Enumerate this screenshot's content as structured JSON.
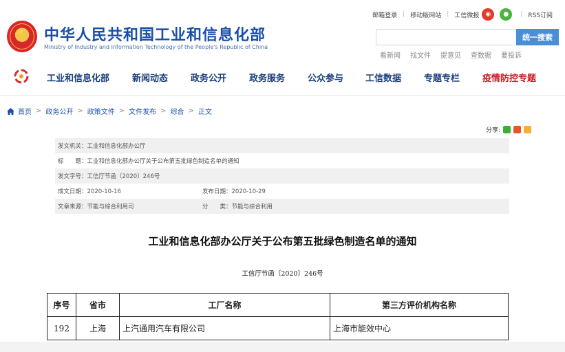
{
  "header": {
    "title": "中华人民共和国工业和信息化部",
    "subtitle": "Ministry of Industry and Information Technology of the People's Republic of China",
    "top_links": [
      "邮箱登录",
      "移动版网站",
      "工信微报"
    ],
    "rss": "RSS订阅",
    "search_button": "统一搜索",
    "quick_links": [
      "看新闻",
      "找文件",
      "提意见",
      "查数据",
      "要投诉"
    ]
  },
  "nav": {
    "items": [
      "工业和信息化部",
      "新闻动态",
      "政务公开",
      "政务服务",
      "公众参与",
      "工信数据",
      "专题专栏",
      "疫情防控专题"
    ]
  },
  "breadcrumb": [
    "首页",
    "政务公开",
    "政策文件",
    "文件发布",
    "综合",
    "正文"
  ],
  "share_label": "分享:",
  "meta": {
    "issuer": "发文机关：工业和信息化部办公厅",
    "title": "标　　题：工业和信息化部办公厅关于公布第五批绿色制造名单的通知",
    "doc_no": "发文字号：工信厅节函〔2020〕246号",
    "created": "成文日期：2020-10-16",
    "published": "发布日期：2020-10-29",
    "source": "文章来源：节能与综合利用司",
    "category": "分　　类：节能与综合利用"
  },
  "article": {
    "title": "工业和信息化部办公厅关于公布第五批绿色制造名单的通知",
    "doc_no": "工信厅节函〔2020〕246号"
  },
  "table": {
    "headers": [
      "序号",
      "省市",
      "工厂名称",
      "第三方评价机构名称"
    ],
    "rows": [
      [
        "192",
        "上海",
        "上汽通用汽车有限公司",
        "上海市能效中心"
      ]
    ]
  },
  "colors": {
    "brand_blue": "#1a4fa8",
    "nav_blue": "#1a3e7a",
    "highlight_red": "#c81d25",
    "search_blue": "#4a8ed8"
  }
}
